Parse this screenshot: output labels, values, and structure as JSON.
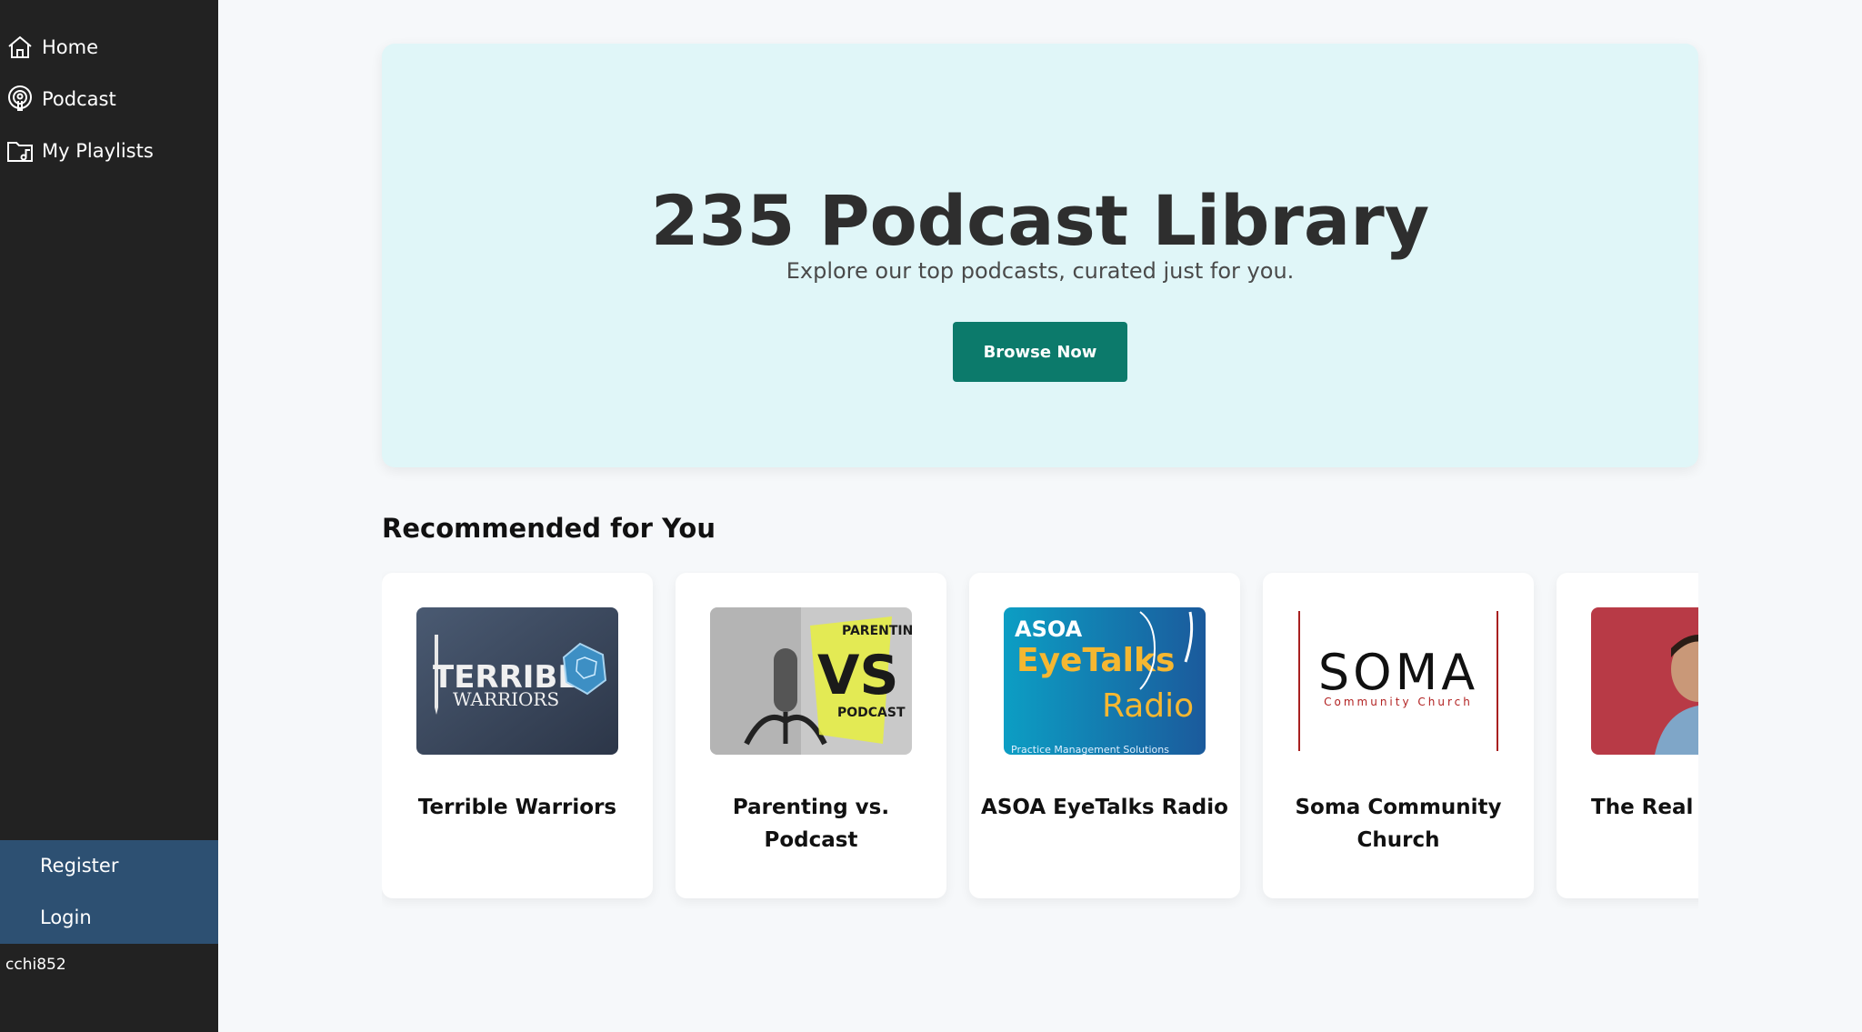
{
  "sidebar": {
    "items": [
      {
        "label": "Home",
        "icon": "home-icon"
      },
      {
        "label": "Podcast",
        "icon": "podcast-icon"
      },
      {
        "label": "My Playlists",
        "icon": "playlist-folder-icon"
      }
    ],
    "register_label": "Register",
    "login_label": "Login",
    "username": "cchi852"
  },
  "hero": {
    "title": "235 Podcast Library",
    "subtitle": "Explore our top podcasts, curated just for you.",
    "button_label": "Browse Now"
  },
  "recommended": {
    "heading": "Recommended for You",
    "cards": [
      {
        "title": "Terrible Warriors",
        "art_text": [
          "TERRIBLE",
          "WARRIORS"
        ]
      },
      {
        "title": "Parenting vs. Podcast",
        "art_text": [
          "PARENTING",
          "VS",
          "PODCAST"
        ]
      },
      {
        "title": "ASOA EyeTalks Radio",
        "art_text": [
          "ASOA",
          "EyeTalks",
          "Radio",
          "Practice Management Solutions"
        ]
      },
      {
        "title": "Soma Community Church",
        "art_text": [
          "SOMA",
          "Community Church"
        ]
      },
      {
        "title": "The Real I",
        "art_text": []
      }
    ]
  },
  "colors": {
    "sidebar_bg": "#222222",
    "auth_bg": "#2d5072",
    "hero_bg": "#e0f6f8",
    "accent": "#0c7a6b"
  }
}
